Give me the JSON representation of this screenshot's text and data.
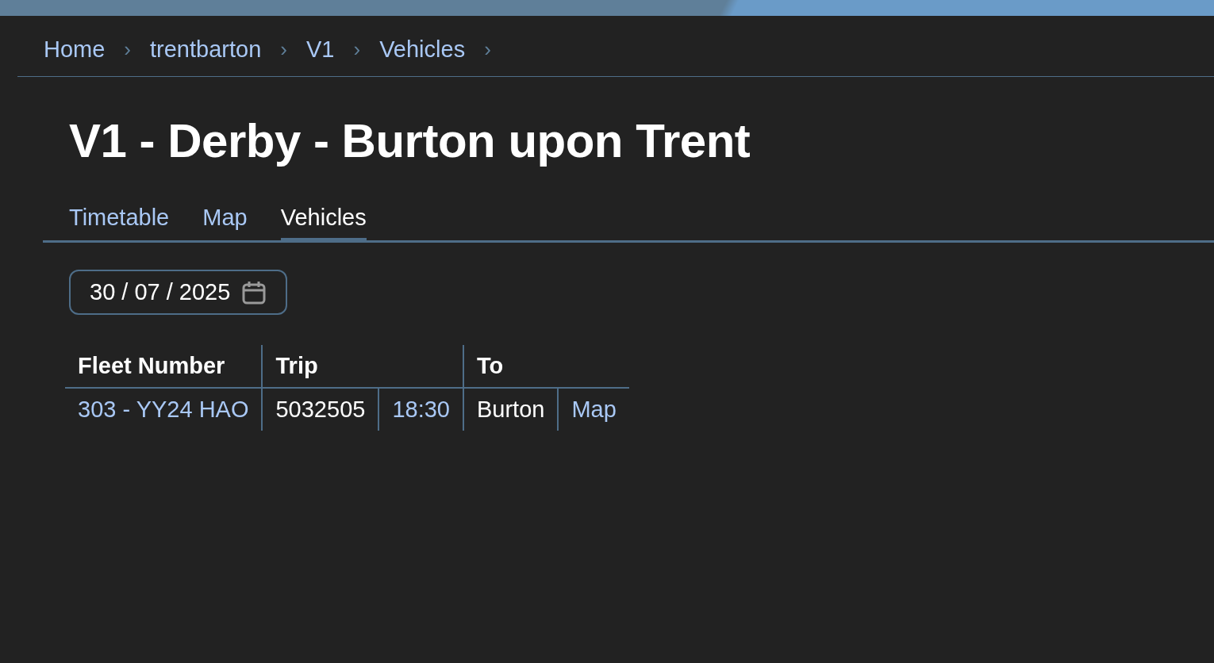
{
  "breadcrumb": [
    {
      "label": "Home",
      "separator": "›"
    },
    {
      "label": "trentbarton",
      "separator": "›"
    },
    {
      "label": "V1",
      "separator": "›"
    },
    {
      "label": "Vehicles",
      "separator": "›"
    }
  ],
  "title": "V1 - Derby - Burton upon Trent",
  "tabs": [
    {
      "label": "Timetable",
      "selected": false
    },
    {
      "label": "Map",
      "selected": false
    },
    {
      "label": "Vehicles",
      "selected": true
    }
  ],
  "date_field": {
    "value": "30 / 07 / 2025"
  },
  "table": {
    "columns": [
      {
        "label": "Fleet Number"
      },
      {
        "label": "Trip"
      },
      {
        "label": "To"
      }
    ],
    "rows": [
      {
        "groups": [
          [
            {
              "text": "303 - YY24 HAO",
              "kind": "link"
            }
          ],
          [
            {
              "text": "5032505",
              "kind": "text"
            },
            {
              "text": "18:30",
              "kind": "link"
            }
          ],
          [
            {
              "text": "Burton",
              "kind": "text"
            },
            {
              "text": "Map",
              "kind": "link"
            }
          ]
        ]
      }
    ]
  }
}
